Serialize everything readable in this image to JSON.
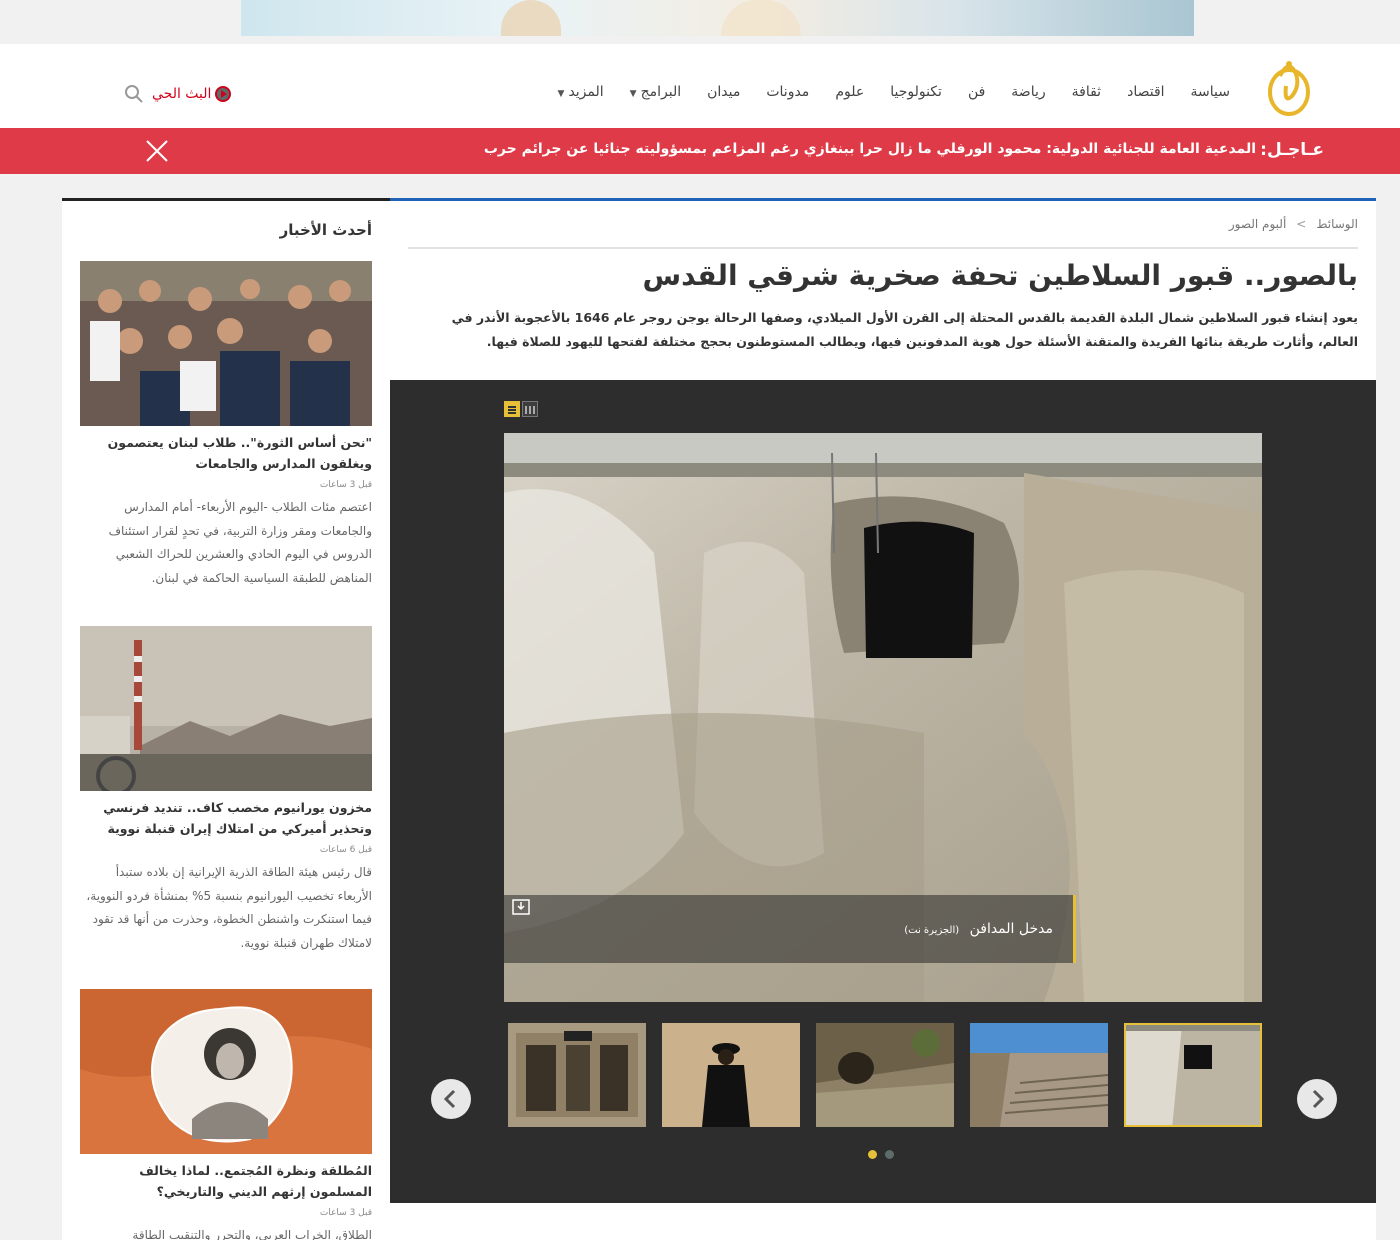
{
  "header": {
    "nav": [
      {
        "label": "سياسة"
      },
      {
        "label": "اقتصاد"
      },
      {
        "label": "ثقافة"
      },
      {
        "label": "رياضة"
      },
      {
        "label": "فن"
      },
      {
        "label": "تكنولوجيا"
      },
      {
        "label": "علوم"
      },
      {
        "label": "مدونات"
      },
      {
        "label": "ميدان"
      },
      {
        "label": "البرامج",
        "dropdown": true
      },
      {
        "label": "المزيد",
        "dropdown": true
      }
    ],
    "live_label": "البث الحي",
    "icons": {
      "logo": "aljazeera-logo",
      "search": "search-icon",
      "live": "play-circle-icon"
    }
  },
  "breaking": {
    "label": "عـاجـل:",
    "text": "المدعية العامة للجنائية الدولية: محمود الورفلي ما زال حرا ببنغازي رغم المزاعم بمسؤوليته جنائيا عن جرائم حرب",
    "close_icon": "close-icon"
  },
  "article": {
    "breadcrumb": [
      "الوسائط",
      "ألبوم الصور"
    ],
    "breadcrumb_sep": ">",
    "title": "بالصور.. قبور السلاطين تحفة صخرية شرقي القدس",
    "lead": "يعود إنشاء قبور السلاطين شمال البلدة القديمة بالقدس المحتلة إلى القرن الأول الميلادي، وصفها الرحالة يوجن روجر عام 1646 بالأعجوبة الأندر في العالم، وأثارت طريقة بنائها الفريدة والمتقنة الأسئلة حول هوية المدفونين فيها، ويطالب المستوطنون بحجج مختلفة لفتحها لليهود للصلاة فيها.",
    "gallery": {
      "caption": "مدخل المدافن",
      "credit": "(الجزيرة نت)",
      "thumbnails": [
        "thumb-tomb-facade",
        "thumb-man-wall",
        "thumb-cave-ruins",
        "thumb-stone-steps",
        "thumb-tomb-entrance"
      ],
      "selected_index": 4,
      "page_count": 2,
      "active_page": 2,
      "accent": "#e7c03a"
    }
  },
  "sidebar": {
    "heading": "أحدث الأخبار",
    "cards": [
      {
        "title": "\"نحن أساس الثورة\".. طلاب لبنان يعتصمون ويغلقون المدارس والجامعات",
        "time": "قبل 3 ساعات",
        "excerpt": "اعتصم مئات الطلاب -اليوم الأربعاء- أمام المدارس والجامعات ومقر وزارة التربية، في تحدٍ لقرار استئناف الدروس في اليوم الحادي والعشرين للحراك الشعبي المناهض للطبقة السياسية الحاكمة في لبنان."
      },
      {
        "title": "مخزون يورانيوم مخصب كاف.. تنديد فرنسي وتحذير أميركي من امتلاك إيران قنبلة نووية",
        "time": "قبل 6 ساعات",
        "excerpt": "قال رئيس هيئة الطاقة الذرية الإيرانية إن بلاده ستبدأ الأربعاء تخصيب اليورانيوم بنسبة 5% بمنشأة فردو النووية، فيما استنكرت واشنطن الخطوة، وحذرت من أنها قد تقود لامتلاك طهران قنبلة نووية."
      },
      {
        "title": "المُطلقة ونظرة المُجتمع.. لماذا يخالف المسلمون إرثهم الديني والتاريخي؟",
        "time": "قبل 3 ساعات",
        "excerpt": "الطلاق، الخراب العربي، والتحرر والتنقيب الطاقة"
      }
    ]
  },
  "colors": {
    "breaking_bg": "#de3a47",
    "article_border": "#1f62b8",
    "live": "#d0021b"
  }
}
